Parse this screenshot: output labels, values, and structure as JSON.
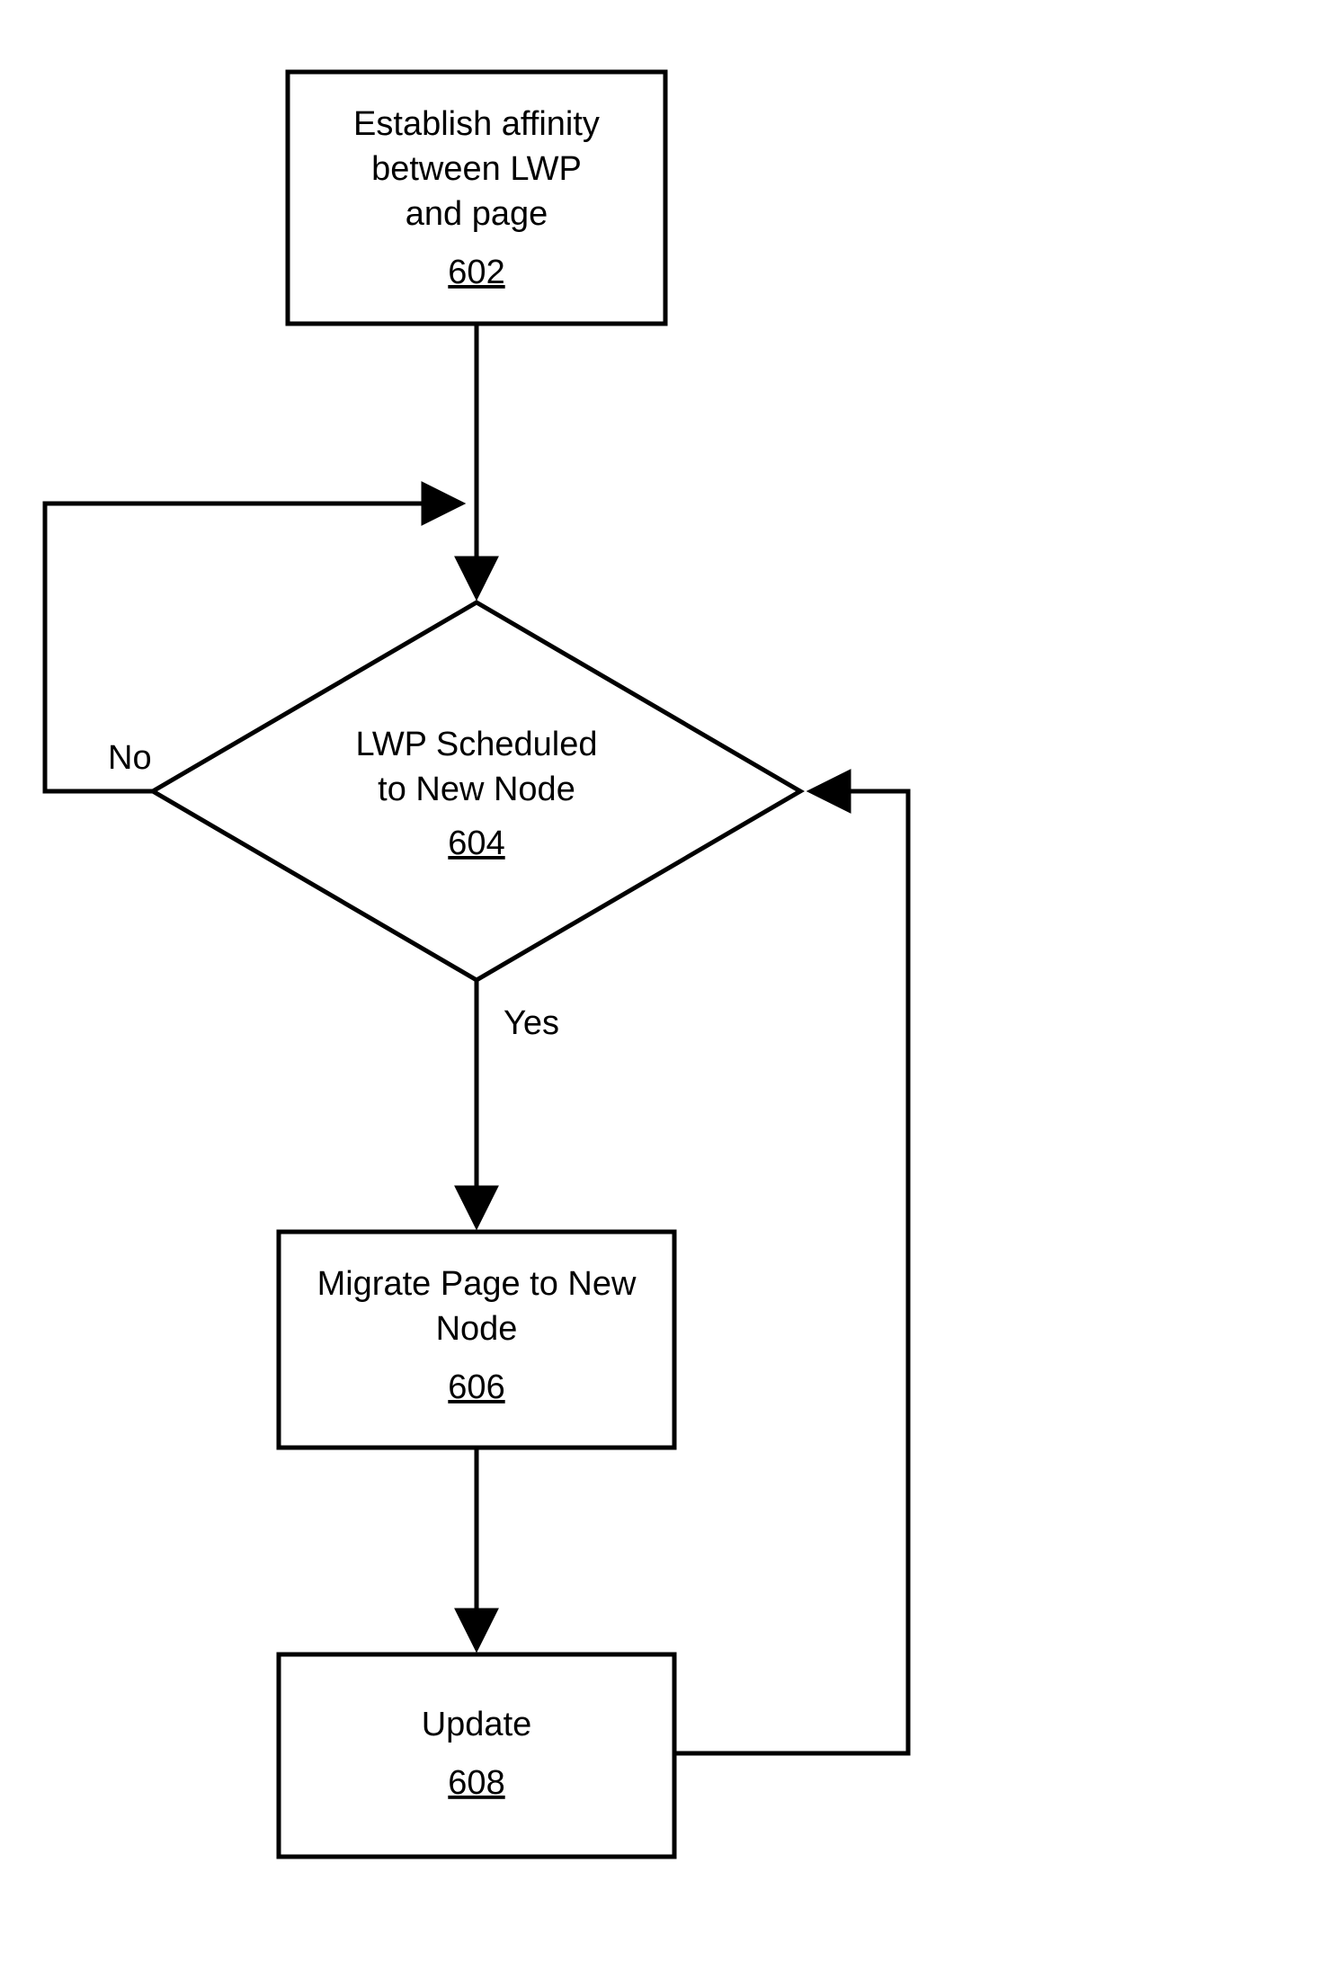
{
  "chart_data": {
    "type": "flowchart",
    "nodes": [
      {
        "id": "602",
        "shape": "rect",
        "lines": [
          "Establish affinity",
          "between LWP",
          "and page"
        ],
        "ref": "602"
      },
      {
        "id": "604",
        "shape": "diamond",
        "lines": [
          "LWP Scheduled",
          "to New Node"
        ],
        "ref": "604"
      },
      {
        "id": "606",
        "shape": "rect",
        "lines": [
          "Migrate Page to New",
          "Node"
        ],
        "ref": "606"
      },
      {
        "id": "608",
        "shape": "rect",
        "lines": [
          "Update"
        ],
        "ref": "608"
      }
    ],
    "edges": [
      {
        "from": "602",
        "to": "604"
      },
      {
        "from": "604",
        "to": "606",
        "label": "Yes"
      },
      {
        "from": "604",
        "to": "604",
        "label": "No",
        "loop": true
      },
      {
        "from": "606",
        "to": "608"
      },
      {
        "from": "608",
        "to": "604",
        "loop": true
      }
    ]
  }
}
